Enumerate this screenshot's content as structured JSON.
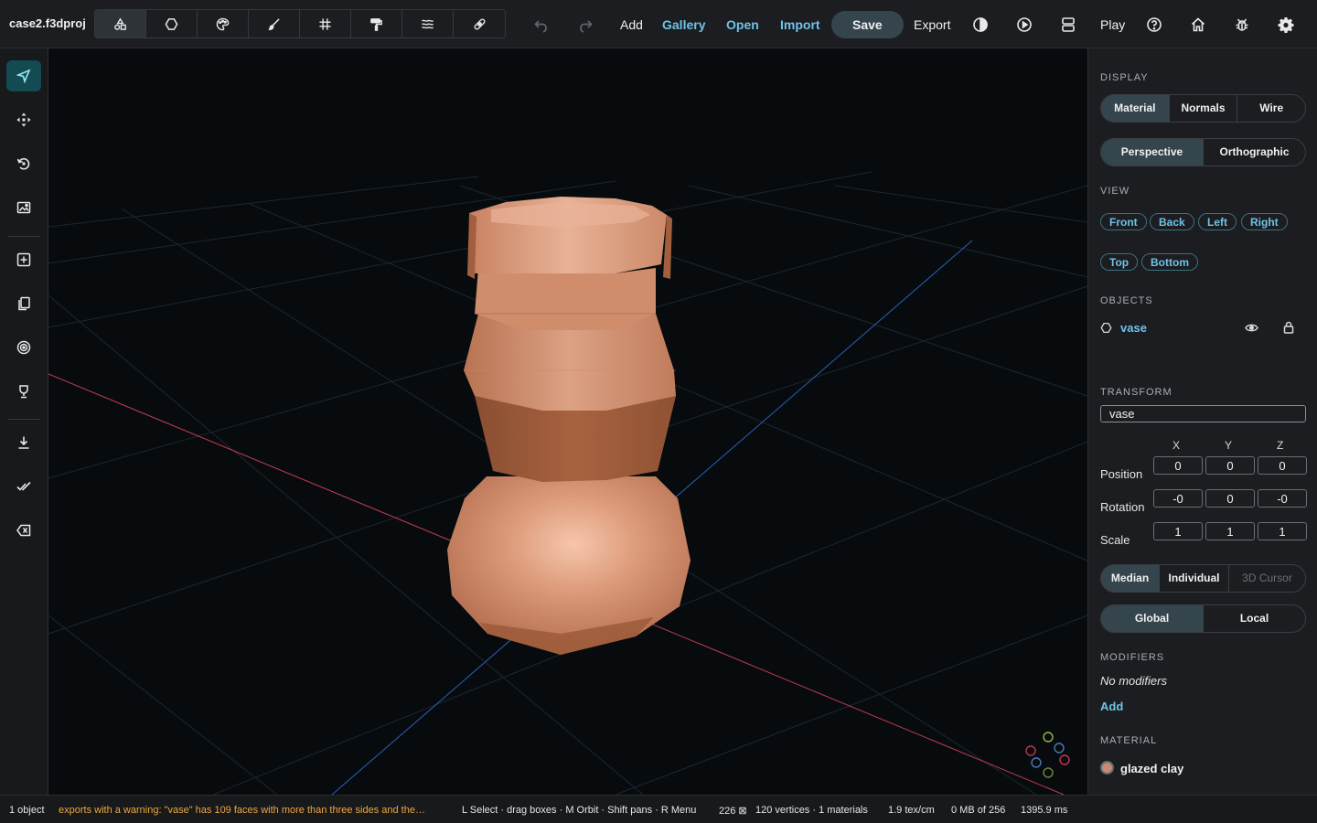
{
  "header": {
    "file_title": "case2.f3dproj",
    "modes": [
      {
        "icon": "shapes-icon",
        "active": true
      },
      {
        "icon": "polygon-icon",
        "active": false
      },
      {
        "icon": "palette-icon",
        "active": false
      },
      {
        "icon": "brush-icon",
        "active": false
      },
      {
        "icon": "grid-icon",
        "active": false
      },
      {
        "icon": "paint-roller-icon",
        "active": false
      },
      {
        "icon": "layers-icon",
        "active": false
      },
      {
        "icon": "bandage-icon",
        "active": false
      }
    ],
    "add_label": "Add",
    "gallery_label": "Gallery",
    "open_label": "Open",
    "import_label": "Import",
    "save_label": "Save",
    "export_label": "Export",
    "play_label": "Play"
  },
  "tools": [
    {
      "icon": "select-arrow-icon",
      "active": true
    },
    {
      "icon": "move-icon",
      "active": false
    },
    {
      "icon": "rotate-icon",
      "active": false
    },
    {
      "icon": "scale-image-icon",
      "active": false
    },
    {
      "icon": "add-box-icon",
      "active": false
    },
    {
      "icon": "duplicate-icon",
      "active": false
    },
    {
      "icon": "target-icon",
      "active": false
    },
    {
      "icon": "trophy-icon",
      "active": false
    },
    {
      "icon": "download-icon",
      "active": false
    },
    {
      "icon": "double-check-icon",
      "active": false
    },
    {
      "icon": "backspace-icon",
      "active": false
    }
  ],
  "panel": {
    "display_label": "DISPLAY",
    "shading": [
      "Material",
      "Normals",
      "Wire"
    ],
    "projection": [
      "Perspective",
      "Orthographic"
    ],
    "view_label": "VIEW",
    "views_row1": [
      "Front",
      "Back",
      "Left",
      "Right"
    ],
    "views_row2": [
      "Top",
      "Bottom"
    ],
    "objects_label": "OBJECTS",
    "object_name": "vase",
    "transform_label": "TRANSFORM",
    "transform_name": "vase",
    "axes": [
      "X",
      "Y",
      "Z"
    ],
    "position_label": "Position",
    "position": [
      "0",
      "0",
      "0"
    ],
    "rotation_label": "Rotation",
    "rotation": [
      "-0",
      "0",
      "-0"
    ],
    "scale_label": "Scale",
    "scale": [
      "1",
      "1",
      "1"
    ],
    "pivot": [
      "Median",
      "Individual",
      "3D Cursor"
    ],
    "space": [
      "Global",
      "Local"
    ],
    "modifiers_label": "MODIFIERS",
    "no_modifiers": "No modifiers",
    "add_modifier": "Add",
    "material_label": "MATERIAL",
    "material_name": "glazed clay",
    "material_color": "#c98a6e"
  },
  "status": {
    "objects": "1 object",
    "warning": "exports with a warning: \"vase\" has 109 faces with more than three sides and the…",
    "hints": "L Select · drag boxes · M Orbit · Shift pans · R Menu",
    "faces": "226 ⊠",
    "vertices": "120 vertices · 1 materials",
    "texel": "1.9 tex/cm",
    "memory": "0 MB of 256",
    "time": "1395.9 ms"
  },
  "colors": {
    "accent": "#6fc3e8",
    "warning": "#f0a640",
    "active_tool": "#144a52",
    "clay": "#d99a78"
  }
}
